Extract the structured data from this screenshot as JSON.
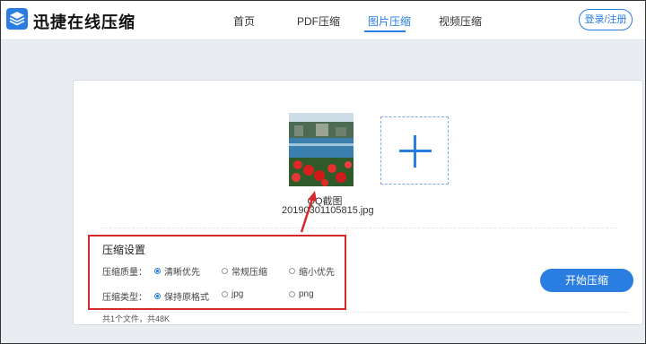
{
  "header": {
    "brand": "迅捷在线压缩",
    "nav": [
      "首页",
      "PDF压缩",
      "图片压缩",
      "视频压缩"
    ],
    "active_nav": "图片压缩",
    "login_label": "登录/注册"
  },
  "upload": {
    "file_name": "QQ截图",
    "file_full": "20190301105815.jpg"
  },
  "settings": {
    "title": "压缩设置",
    "quality_label": "压缩质量：",
    "quality_options": [
      "清晰优先",
      "常规压缩",
      "缩小优先"
    ],
    "quality_selected": "清晰优先",
    "type_label": "压缩类型：",
    "type_options": [
      "保持原格式",
      "jpg",
      "png"
    ],
    "type_selected": "保持原格式"
  },
  "actions": {
    "start_label": "开始压缩"
  },
  "footer": {
    "summary": "共1个文件，共48K"
  },
  "colors": {
    "accent": "#2a7de1",
    "highlight": "#d32b2b"
  }
}
